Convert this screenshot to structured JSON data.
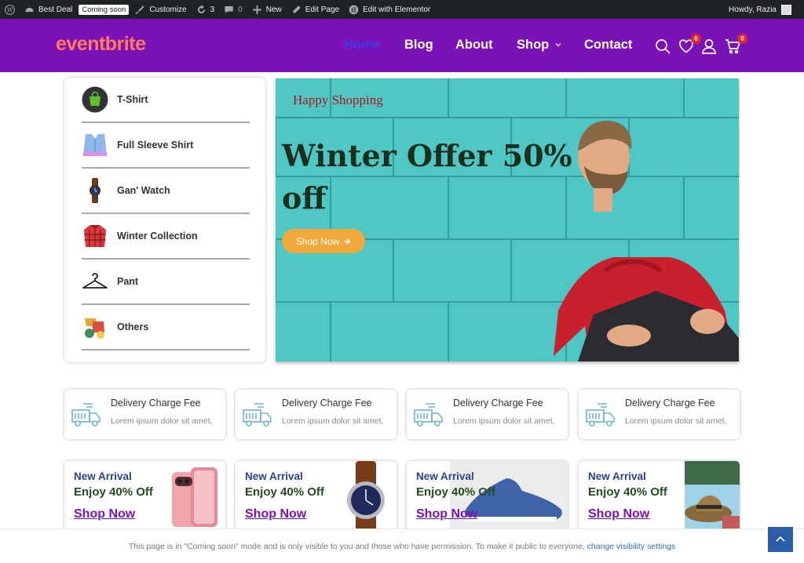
{
  "adminbar": {
    "site_name": "Best Deal",
    "coming_soon": "Coming soon",
    "customize": "Customize",
    "updates_count": "3",
    "comments_count": "0",
    "new": "New",
    "edit_page": "Edit Page",
    "edit_elementor": "Edit with Elementor",
    "howdy": "Howdy, Razia"
  },
  "header": {
    "logo": "eventbrite",
    "nav": [
      "Home",
      "Blog",
      "About",
      "Shop",
      "Contact"
    ],
    "wishlist_count": "0",
    "cart_count": "0"
  },
  "categories": [
    {
      "label": "T-Shirt",
      "icon": "shopping-bag-icon"
    },
    {
      "label": "Full Sleeve Shirt",
      "icon": "shirt-icon"
    },
    {
      "label": "Gan' Watch",
      "icon": "wristwatch-icon"
    },
    {
      "label": "Winter Collection",
      "icon": "winter-jacket-icon"
    },
    {
      "label": "Pant",
      "icon": "hanger-icon"
    },
    {
      "label": "Others",
      "icon": "clothes-pile-icon"
    }
  ],
  "hero": {
    "subtitle": "Happy Shopping",
    "title": "Winter Offer 50% off",
    "button": "Shop Now"
  },
  "delivery_cards": [
    {
      "title": "Delivery Charge Fee",
      "desc": "Lorem ipsum dolor sit amet,"
    },
    {
      "title": "Delivery Charge Fee",
      "desc": "Lorem ipsum dolor sit amet,"
    },
    {
      "title": "Delivery Charge Fee",
      "desc": "Lorem ipsum dolor sit amet,"
    },
    {
      "title": "Delivery Charge Fee",
      "desc": "Lorem ipsum dolor sit amet,"
    }
  ],
  "arrival_cards": [
    {
      "tag": "New Arrival",
      "offer": "Enjoy 40% Off",
      "link": "Shop Now",
      "image": "pink-phone"
    },
    {
      "tag": "New Arrival",
      "offer": "Enjoy 40% Off",
      "link": "Shop Now",
      "image": "wristwatch"
    },
    {
      "tag": "New Arrival",
      "offer": "Enjoy 40% Off",
      "link": "Shop Now",
      "image": "blue-sneaker"
    },
    {
      "tag": "New Arrival",
      "offer": "Enjoy 40% Off",
      "link": "Shop Now",
      "image": "straw-hat"
    }
  ],
  "notice": {
    "text": "This page is in \"Coming soon\" mode and is only visible to you and those who have permission. To make it public to everyone,",
    "link": "change visibility settings"
  },
  "colors": {
    "header": "#7a12b8",
    "logo": "#ff7a59",
    "active_nav": "#3e3bdb",
    "hero_bg": "#4fc7c4",
    "button": "#f2a93b",
    "badge": "#e3262a"
  }
}
